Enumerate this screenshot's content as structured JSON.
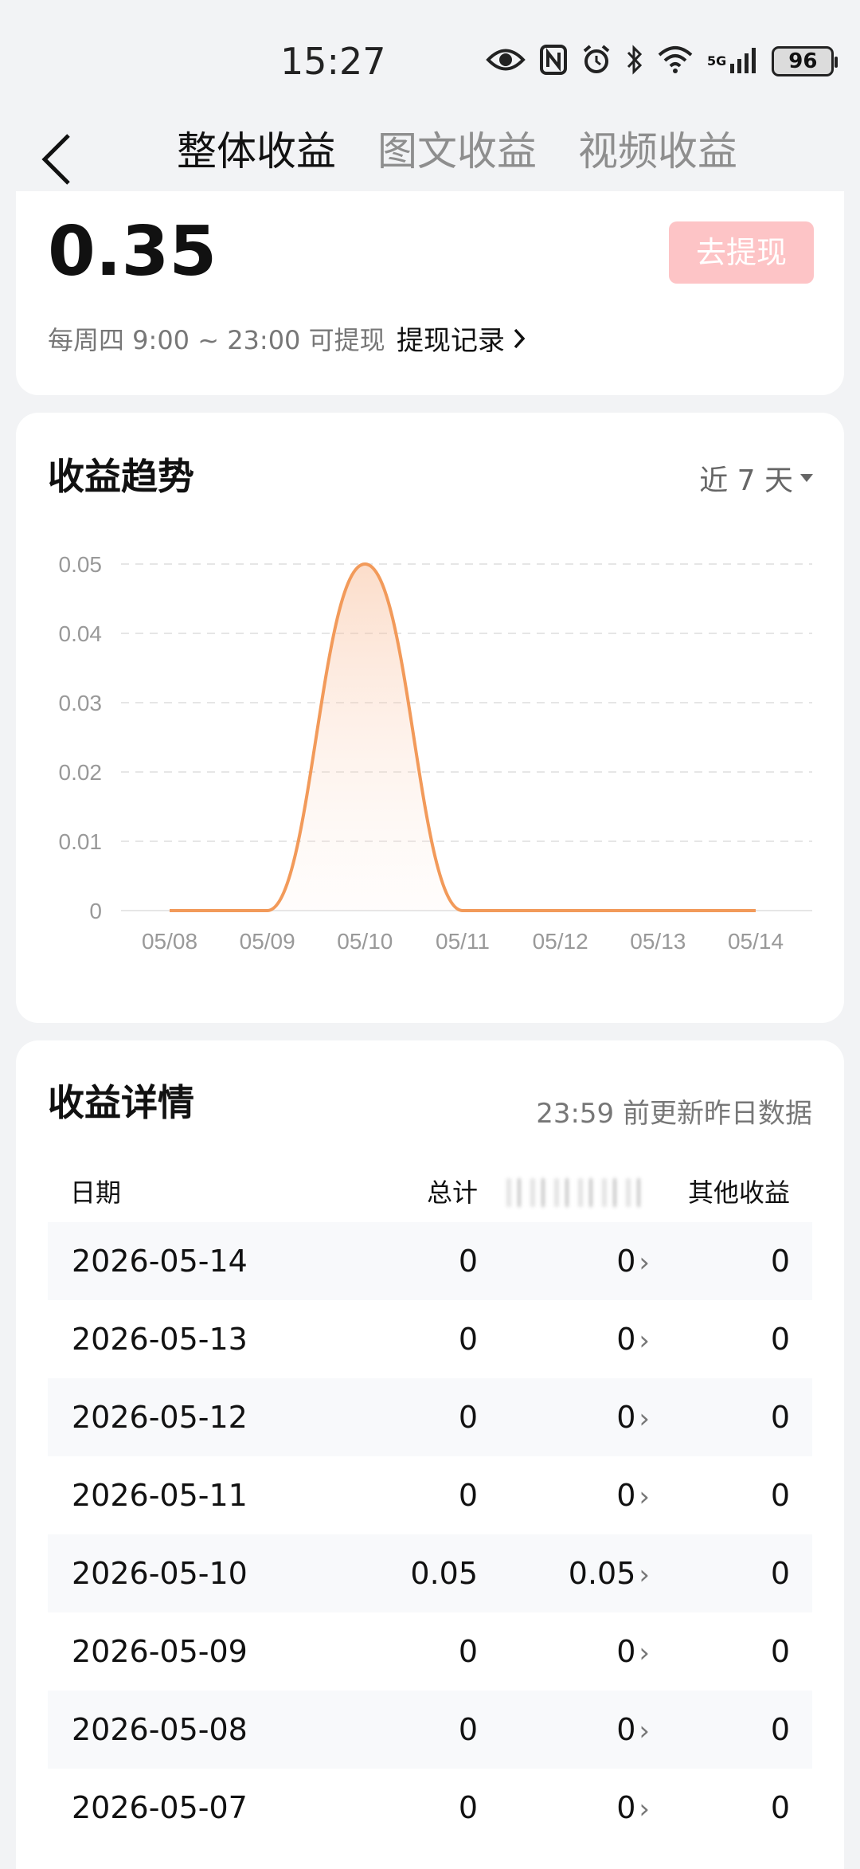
{
  "status_bar": {
    "time": "15:27",
    "network": "5G",
    "battery": "96"
  },
  "nav": {
    "tabs": [
      {
        "label": "整体收益",
        "active": true
      },
      {
        "label": "图文收益",
        "active": false
      },
      {
        "label": "视频收益",
        "active": false
      }
    ]
  },
  "balance": {
    "amount": "0.35",
    "withdraw_button": "去提现",
    "hint": "每周四 9:00 ~ 23:00 可提现",
    "record_link": "提现记录"
  },
  "trend": {
    "title": "收益趋势",
    "range": "近 7 天"
  },
  "chart_data": {
    "type": "area",
    "x": [
      "05/08",
      "05/09",
      "05/10",
      "05/11",
      "05/12",
      "05/13",
      "05/14"
    ],
    "series": [
      {
        "values": [
          0,
          0,
          0.05,
          0,
          0,
          0,
          0
        ]
      }
    ],
    "y_ticks": [
      "0.05",
      "0.04",
      "0.03",
      "0.02",
      "0.01",
      "0"
    ],
    "ylim": [
      0,
      0.05
    ],
    "grid": true,
    "color": "#f29a5a"
  },
  "detail": {
    "title": "收益详情",
    "update_note": "23:59 前更新昨日数据",
    "columns": [
      "日期",
      "总计",
      "",
      "其他收益"
    ],
    "rows": [
      {
        "date": "2026-05-14",
        "total": "0",
        "mid": "0",
        "other": "0"
      },
      {
        "date": "2026-05-13",
        "total": "0",
        "mid": "0",
        "other": "0"
      },
      {
        "date": "2026-05-12",
        "total": "0",
        "mid": "0",
        "other": "0"
      },
      {
        "date": "2026-05-11",
        "total": "0",
        "mid": "0",
        "other": "0"
      },
      {
        "date": "2026-05-10",
        "total": "0.05",
        "mid": "0.05",
        "other": "0"
      },
      {
        "date": "2026-05-09",
        "total": "0",
        "mid": "0",
        "other": "0"
      },
      {
        "date": "2026-05-08",
        "total": "0",
        "mid": "0",
        "other": "0"
      },
      {
        "date": "2026-05-07",
        "total": "0",
        "mid": "0",
        "other": "0"
      }
    ]
  }
}
